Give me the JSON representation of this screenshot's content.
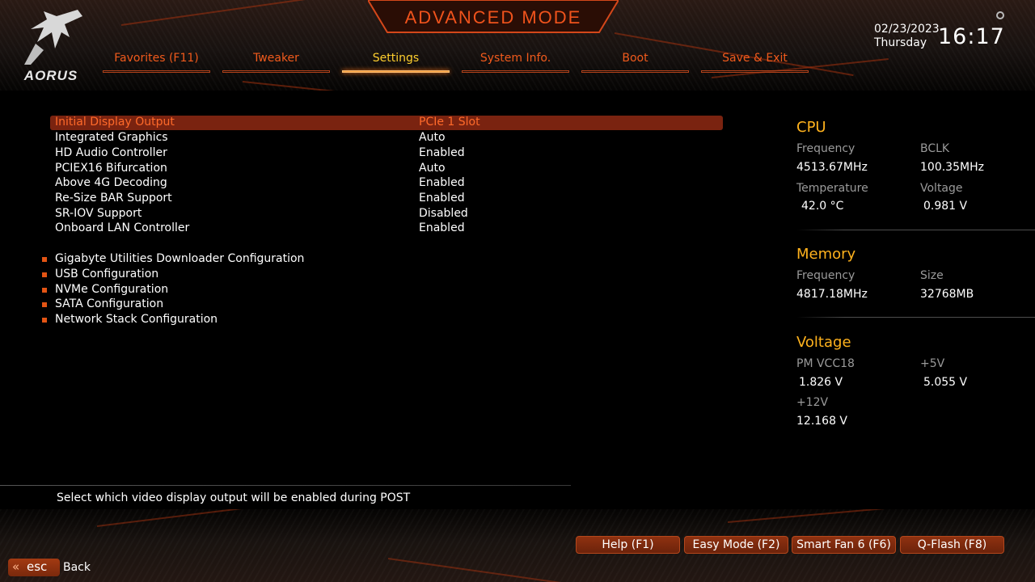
{
  "header": {
    "title": "ADVANCED MODE",
    "logo_text": "AORUS",
    "date": "02/23/2023",
    "day": "Thursday",
    "time": "16:17"
  },
  "tabs": [
    {
      "label": "Favorites (F11)",
      "active": false
    },
    {
      "label": "Tweaker",
      "active": false
    },
    {
      "label": "Settings",
      "active": true
    },
    {
      "label": "System Info.",
      "active": false
    },
    {
      "label": "Boot",
      "active": false
    },
    {
      "label": "Save & Exit",
      "active": false
    }
  ],
  "settings": [
    {
      "label": "Initial Display Output",
      "value": "PCIe 1 Slot",
      "selected": true
    },
    {
      "label": "Integrated Graphics",
      "value": "Auto"
    },
    {
      "label": "HD Audio Controller",
      "value": "Enabled"
    },
    {
      "label": "PCIEX16 Bifurcation",
      "value": "Auto"
    },
    {
      "label": "Above 4G Decoding",
      "value": "Enabled"
    },
    {
      "label": "Re-Size BAR Support",
      "value": "Enabled"
    },
    {
      "label": "SR-IOV Support",
      "value": "Disabled"
    },
    {
      "label": "Onboard LAN Controller",
      "value": "Enabled"
    }
  ],
  "submenus": [
    "Gigabyte Utilities Downloader Configuration",
    "USB Configuration",
    "NVMe Configuration",
    "SATA Configuration",
    "Network Stack Configuration"
  ],
  "panel": {
    "cpu": {
      "title": "CPU",
      "frequency_label": "Frequency",
      "frequency_value": "4513.67MHz",
      "bclk_label": "BCLK",
      "bclk_value": "100.35MHz",
      "temperature_label": "Temperature",
      "temperature_value": "42.0 °C",
      "voltage_label": "Voltage",
      "voltage_value": "0.981 V"
    },
    "memory": {
      "title": "Memory",
      "frequency_label": "Frequency",
      "frequency_value": "4817.18MHz",
      "size_label": "Size",
      "size_value": "32768MB"
    },
    "voltage": {
      "title": "Voltage",
      "pmvcc18_label": "PM VCC18",
      "pmvcc18_value": "1.826 V",
      "plus5v_label": "+5V",
      "plus5v_value": "5.055 V",
      "plus12v_label": "+12V",
      "plus12v_value": "12.168 V"
    }
  },
  "help_text": "Select which video display output will be enabled during POST",
  "footer": {
    "buttons": [
      "Help (F1)",
      "Easy Mode (F2)",
      "Smart Fan 6 (F6)",
      "Q-Flash (F8)"
    ],
    "esc_label": "esc",
    "back_label": "Back"
  },
  "colors": {
    "accent": "#f05a1c",
    "active_tab": "#ffcf2e",
    "section_title": "#ffb21d",
    "selection_bg": "#7a2310"
  }
}
